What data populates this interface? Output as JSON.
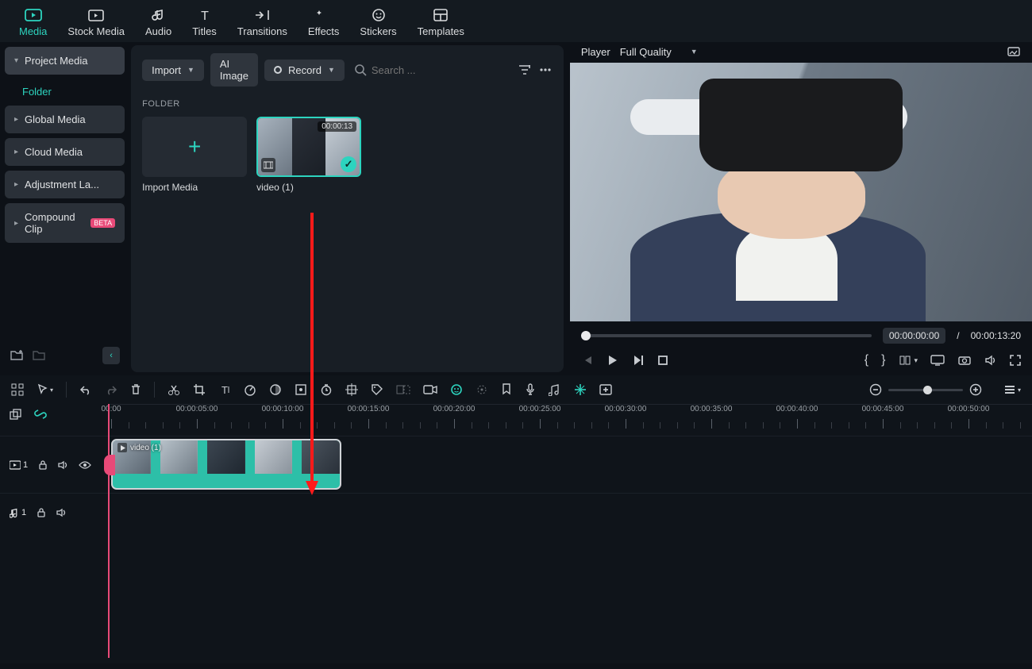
{
  "top_tabs": [
    "Media",
    "Stock Media",
    "Audio",
    "Titles",
    "Transitions",
    "Effects",
    "Stickers",
    "Templates"
  ],
  "top_active": 0,
  "sidebar": {
    "project_media": "Project Media",
    "folder": "Folder",
    "global_media": "Global Media",
    "cloud_media": "Cloud Media",
    "adjustment": "Adjustment La...",
    "compound": "Compound Clip",
    "compound_badge": "BETA"
  },
  "browser": {
    "import_btn": "Import",
    "ai_image_btn": "AI Image",
    "record_btn": "Record",
    "search_placeholder": "Search ...",
    "folder_label": "FOLDER",
    "import_media": "Import Media",
    "clip": {
      "name": "video (1)",
      "duration": "00:00:13"
    }
  },
  "player": {
    "label": "Player",
    "quality": "Full Quality",
    "current": "00:00:00:00",
    "sep": "/",
    "total": "00:00:13:20"
  },
  "ruler": [
    "00:00",
    "00:00:05:00",
    "00:00:10:00",
    "00:00:15:00",
    "00:00:20:00",
    "00:00:25:00",
    "00:00:30:00",
    "00:00:35:00",
    "00:00:40:00",
    "00:00:45:00",
    "00:00:50:00"
  ],
  "tracks": {
    "video_num": "1",
    "audio_num": "1",
    "clip_label": "video (1)"
  }
}
